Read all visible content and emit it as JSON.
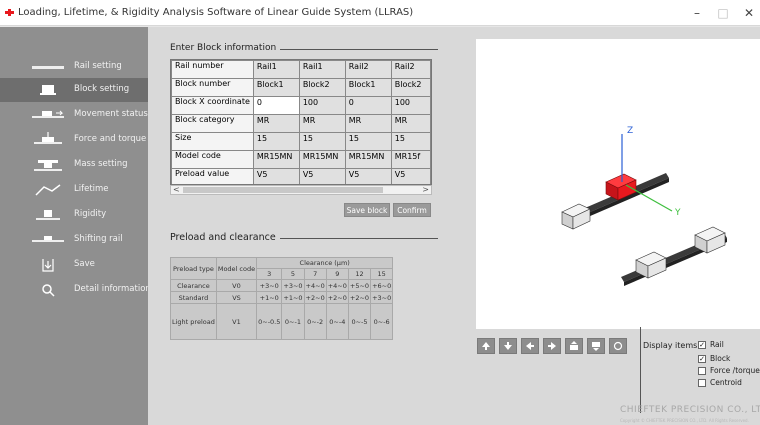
{
  "window": {
    "title": "Loading, Lifetime, & Rigidity Analysis Software of Linear Guide System (LLRAS)",
    "minimize": "–",
    "maximize": "□",
    "close": "✕"
  },
  "sidebar": {
    "items": [
      {
        "label": "Rail setting",
        "icon": "rail-icon",
        "active": false
      },
      {
        "label": "Block setting",
        "icon": "block-icon",
        "active": true
      },
      {
        "label": "Movement status",
        "icon": "movement-icon",
        "active": false
      },
      {
        "label": "Force and torque",
        "icon": "force-torque-icon",
        "active": false
      },
      {
        "label": "Mass setting",
        "icon": "mass-icon",
        "active": false
      },
      {
        "label": "Lifetime",
        "icon": "lifetime-icon",
        "active": false
      },
      {
        "label": "Rigidity",
        "icon": "rigidity-icon",
        "active": false
      },
      {
        "label": "Shifting rail",
        "icon": "shift-rail-icon",
        "active": false
      },
      {
        "label": "Save",
        "icon": "save-icon",
        "active": false
      },
      {
        "label": "Detail information",
        "icon": "search-icon",
        "active": false
      }
    ]
  },
  "block_info": {
    "group_title": "Enter Block information",
    "row_headers": [
      "Rail number",
      "Block number",
      "Block X coordinate",
      "Block category",
      "Size",
      "Model code",
      "Preload value"
    ],
    "columns": [
      [
        "Rail1",
        "Block1",
        "0",
        "MR",
        "15",
        "MR15MN",
        "V5"
      ],
      [
        "Rail1",
        "Block2",
        "100",
        "MR",
        "15",
        "MR15MN",
        "V5"
      ],
      [
        "Rail2",
        "Block1",
        "0",
        "MR",
        "15",
        "MR15MN",
        "V5"
      ],
      [
        "Rail2",
        "Block2",
        "100",
        "MR",
        "15",
        "MR15f",
        "V5"
      ]
    ],
    "save_button": "Save block",
    "confirm_button": "Confirm",
    "scroll_left": "<",
    "scroll_right": ">"
  },
  "preload": {
    "group_title": "Preload and clearance",
    "col_preload_type": "Preload type",
    "col_model_code": "Model code",
    "clearance_header": "Clearance (μm)",
    "sizes": [
      "3",
      "5",
      "7",
      "9",
      "12",
      "15"
    ],
    "rows": [
      {
        "type": "Clearance",
        "code": "V0",
        "values": [
          "+3~0",
          "+3~0",
          "+4~0",
          "+4~0",
          "+5~0",
          "+6~0"
        ]
      },
      {
        "type": "Standard",
        "code": "VS",
        "values": [
          "+1~0",
          "+1~0",
          "+2~0",
          "+2~0",
          "+2~0",
          "+3~0"
        ]
      },
      {
        "type": "Light preload",
        "code": "V1",
        "values": [
          "0~-0.5",
          "0~-1",
          "0~-2",
          "0~-4",
          "0~-5",
          "0~-6"
        ]
      }
    ]
  },
  "viewer": {
    "axis_z": "Z",
    "axis_y": "Y",
    "display_items_label": "Display items",
    "items": [
      {
        "label": "Rail",
        "checked": true
      },
      {
        "label": "Block",
        "checked": true
      },
      {
        "label": "Force /torque",
        "checked": false
      },
      {
        "label": "Centroid",
        "checked": false
      }
    ],
    "check_mark": "✓",
    "brand": "CHIEFTEK PRECISION CO., LTD.",
    "brand_sub": "Copyright © CHIEFTEK PRECISION CO., LTD. All Rights Reserved."
  },
  "colors": {
    "sidebar_bg": "#8f8f8f",
    "sidebar_active": "#6e6e6e",
    "block_selected": "#e8191e",
    "axis_z": "#2a5fd6",
    "axis_y": "#3fbf3f"
  }
}
